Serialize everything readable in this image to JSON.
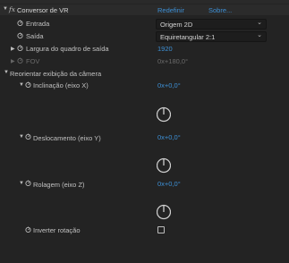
{
  "top_cutoff": {
    "left": "...",
    "right": "..."
  },
  "effect": {
    "fx": "fx",
    "name": "Conversor de VR",
    "reset": "Redefinir",
    "about": "Sobre..."
  },
  "entrada": {
    "label": "Entrada",
    "value": "Origem 2D"
  },
  "saida": {
    "label": "Saída",
    "value": "Equiretangular 2:1"
  },
  "largura": {
    "label": "Largura do quadro de saída",
    "value": "1920"
  },
  "fov": {
    "label": "FOV",
    "value": "0x+180,0°"
  },
  "reorientar": {
    "label": "Reorientar exibição da câmera"
  },
  "inclinacao": {
    "label": "Inclinação (eixo X)",
    "value": "0x+0,0°"
  },
  "deslocamento": {
    "label": "Deslocamento (eixo Y)",
    "value": "0x+0,0°"
  },
  "rolagem": {
    "label": "Rolagem (eixo Z)",
    "value": "0x+0,0°"
  },
  "inverter": {
    "label": "Inverter rotação",
    "checked": false
  },
  "colors": {
    "background": "#232323",
    "link": "#3d8fd4",
    "text": "#c2c2c2",
    "disabled": "#6a6a6a"
  }
}
